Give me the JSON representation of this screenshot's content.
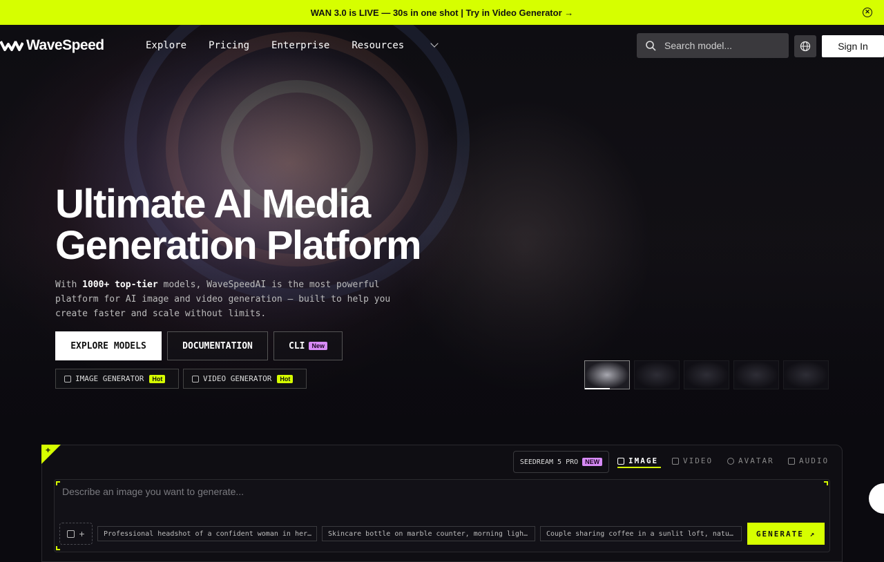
{
  "banner": {
    "text": "WAN 3.0 is LIVE — 30s in one shot | Try in Video Generator →"
  },
  "nav": {
    "logo": "WaveSpeed",
    "links": [
      "Explore",
      "Pricing",
      "Enterprise",
      "Resources"
    ],
    "search_placeholder": "Search model...",
    "signin": "Sign In"
  },
  "hero": {
    "headline_line1": "Ultimate AI Media",
    "headline_line2": "Generation Platform",
    "sub_pre": "With ",
    "sub_bold": "1000+ top-tier",
    "sub_post": " models, WaveSpeedAI is the most powerful platform for AI image and video generation — built to help you create faster and scale without limits.",
    "btn_explore": "EXPLORE MODELS",
    "btn_docs": "DOCUMENTATION",
    "btn_cli": "CLI",
    "badge_new": "New",
    "gen_image": "IMAGE GENERATOR",
    "gen_video": "VIDEO GENERATOR",
    "badge_hot": "Hot"
  },
  "generator": {
    "model": "SEEDREAM 5 PRO",
    "model_badge": "NEW",
    "tabs": [
      "IMAGE",
      "VIDEO",
      "AVATAR",
      "AUDIO"
    ],
    "prompt_placeholder": "Describe an image you want to generate...",
    "attach_plus": "+",
    "chips": [
      "Professional headshot of a confident woman in her…",
      "Skincare bottle on marble counter, morning ligh…",
      "Couple sharing coffee in a sunlit loft, natu…"
    ],
    "generate": "GENERATE ↗"
  },
  "colors": {
    "accent": "#d6ff00",
    "new_badge": "#d68af5"
  }
}
